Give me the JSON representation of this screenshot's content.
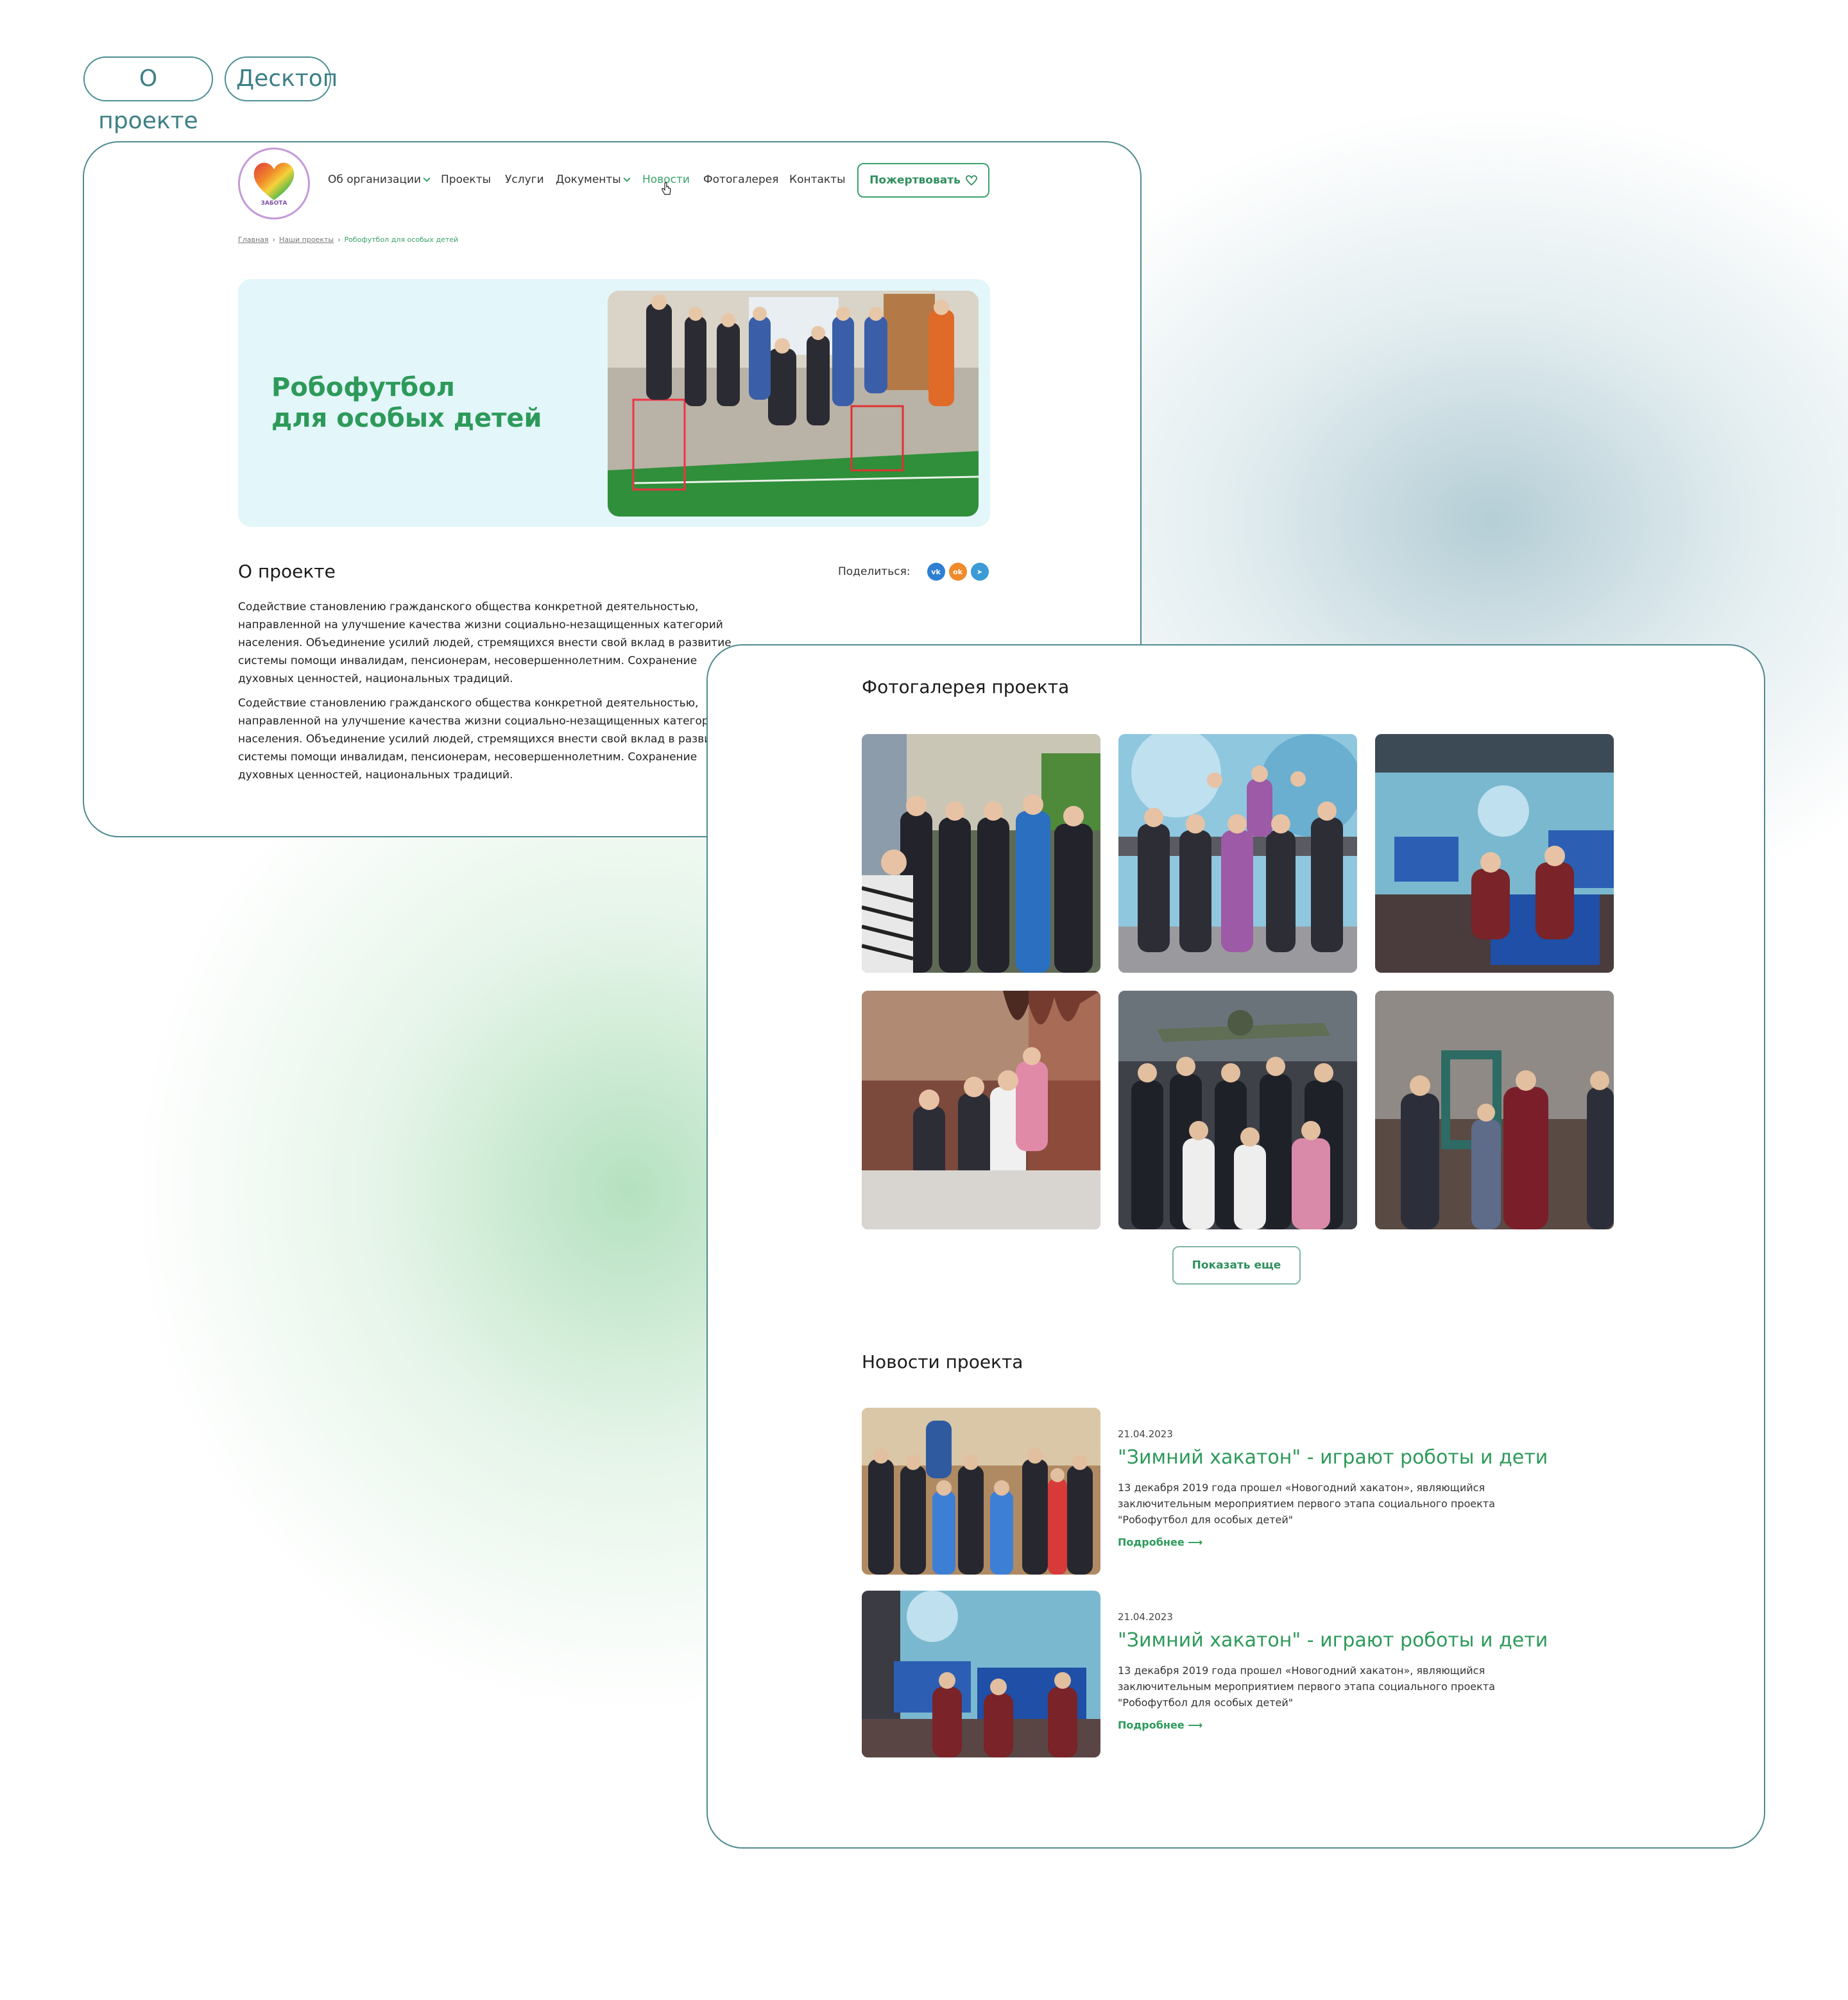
{
  "tags": [
    "О проекте",
    "Десктоп"
  ],
  "logo": {
    "text": "ЗАБОТА"
  },
  "nav": {
    "items": [
      {
        "label": "Об организации",
        "dropdown": true
      },
      {
        "label": "Проекты",
        "dropdown": false
      },
      {
        "label": "Услуги",
        "dropdown": false
      },
      {
        "label": "Документы",
        "dropdown": true
      },
      {
        "label": "Новости",
        "dropdown": false,
        "active": true
      },
      {
        "label": "Фотогалерея",
        "dropdown": false
      },
      {
        "label": "Контакты",
        "dropdown": false
      }
    ],
    "donate_label": "Пожертвовать"
  },
  "breadcrumbs": [
    "Главная",
    "Наши проекты",
    "Робофутбол для особых детей"
  ],
  "hero": {
    "title": "Робофутбол\nдля особых детей"
  },
  "about": {
    "heading": "О проекте",
    "share_label": "Поделиться:",
    "share_icons": [
      "vk-icon",
      "ok-icon",
      "telegram-icon"
    ],
    "paragraphs": [
      "Содействие становлению гражданского общества конкретной деятельностью, направленной на улучшение качества жизни социально-незащищенных категорий населения. Объединение усилий людей, стремящихся внести свой вклад в развитие системы помощи инвалидам, пенсионерам, несовершеннолетним. Сохранение духовных ценностей, национальных традиций.",
      "Содействие становлению гражданского общества конкретной деятельностью, направленной на улучшение качества жизни социально-незащищенных категорий населения. Объединение усилий людей, стремящихся внести свой вклад в развитие системы помощи инвалидам, пенсионерам, несовершеннолетним. Сохранение духовных ценностей, национальных традиций."
    ]
  },
  "gallery": {
    "heading": "Фотогалерея проекта",
    "show_more": "Показать еще"
  },
  "news": {
    "heading": "Новости проекта",
    "items": [
      {
        "date": "21.04.2023",
        "title": "\"Зимний хакатон\" - играют роботы и дети",
        "desc": "13 декабря 2019 года прошел «Новогодний хакатон», являющийся заключительным мероприятием первого этапа социального проекта \"Робофутбол для особых детей\"",
        "link": "Подробнее"
      },
      {
        "date": "21.04.2023",
        "title": "\"Зимний хакатон\" - играют роботы и дети",
        "desc": "13 декабря 2019 года прошел «Новогодний хакатон», являющийся заключительным мероприятием первого этапа социального проекта \"Робофутбол для особых детей\"",
        "link": "Подробнее"
      }
    ]
  },
  "colors": {
    "accent": "#2d9a5a",
    "frame": "#4f8b8f",
    "hero_bg": "#e3f6fa"
  }
}
